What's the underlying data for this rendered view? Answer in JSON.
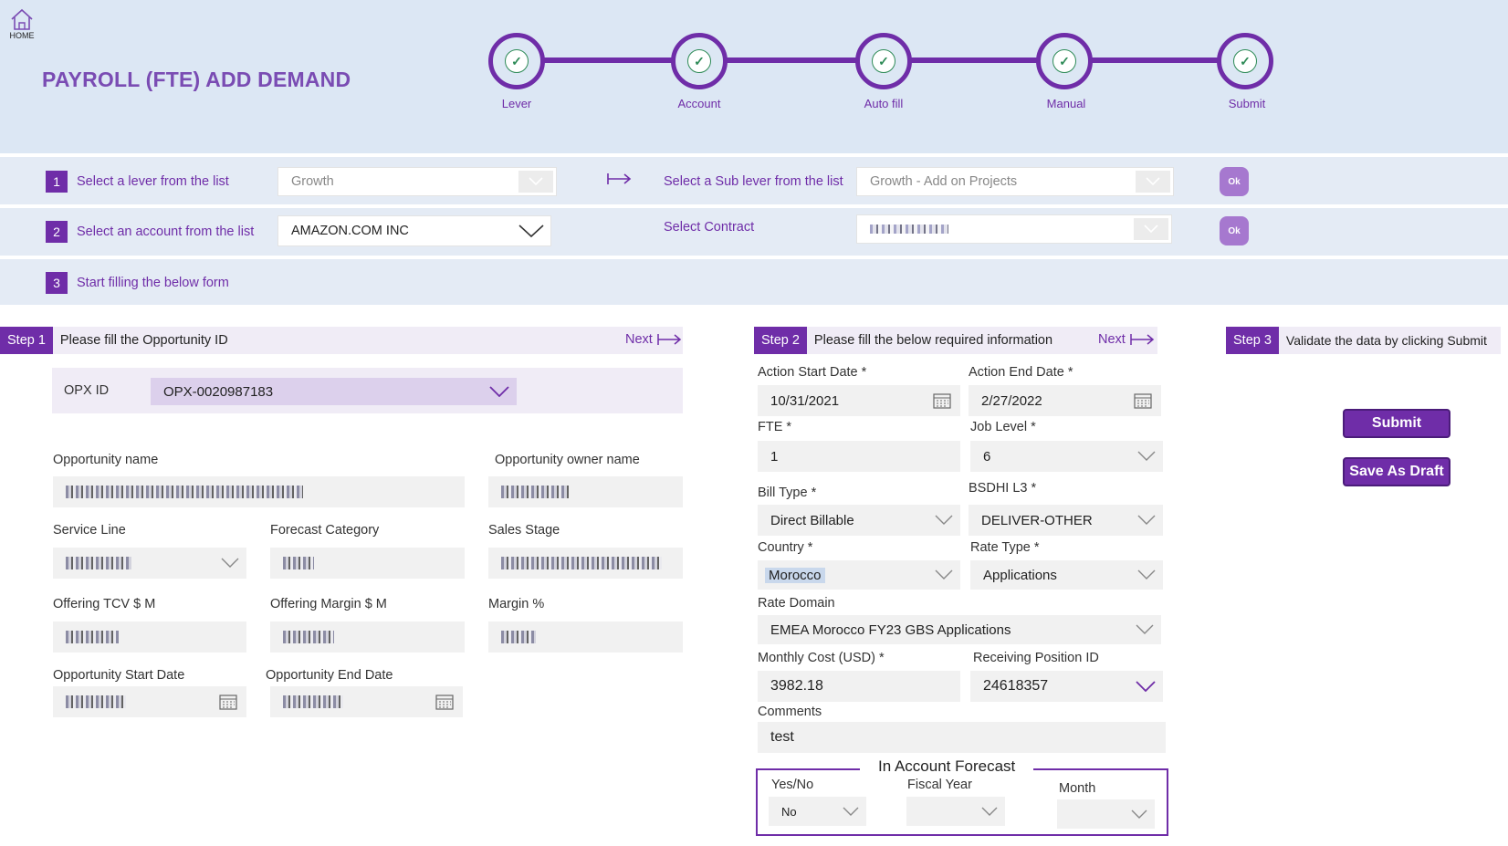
{
  "header": {
    "home_label": "HOME",
    "title": "PAYROLL (FTE) ADD DEMAND",
    "steps": [
      {
        "label": "Lever",
        "done": true
      },
      {
        "label": "Account",
        "done": true
      },
      {
        "label": "Auto fill",
        "done": true
      },
      {
        "label": "Manual",
        "done": true
      },
      {
        "label": "Submit",
        "done": true
      }
    ]
  },
  "selection": {
    "row1": {
      "number": "1",
      "label": "Select a lever from the list",
      "lever_value": "Growth",
      "sub_label": "Select a Sub lever from the list",
      "sub_lever_value": "Growth - Add on Projects",
      "ok": "Ok"
    },
    "row2": {
      "number": "2",
      "label": "Select an account from the list",
      "account_value": "AMAZON.COM INC",
      "contract_label": "Select  Contract",
      "ok": "Ok"
    },
    "row3": {
      "number": "3",
      "label": "Start filling the below form"
    }
  },
  "step1": {
    "tag": "Step 1",
    "title": "Please fill the Opportunity ID",
    "next": "Next",
    "opx_label": "OPX ID",
    "opx_value": "OPX-0020987183",
    "fields": {
      "opportunity_name": "Opportunity name",
      "opportunity_owner": "Opportunity owner name",
      "service_line": "Service Line",
      "forecast_category": "Forecast Category",
      "sales_stage": "Sales Stage",
      "offering_tcv": "Offering TCV $ M",
      "offering_margin": "Offering Margin $ M",
      "margin_pct": "Margin %",
      "opp_start": "Opportunity Start Date",
      "opp_end": "Opportunity End Date"
    }
  },
  "step2": {
    "tag": "Step 2",
    "title": "Please fill the below required information",
    "next": "Next",
    "action_start_label": "Action Start Date *",
    "action_start_value": "10/31/2021",
    "action_end_label": "Action End Date *",
    "action_end_value": "2/27/2022",
    "fte_label": "FTE *",
    "fte_value": "1",
    "job_level_label": "Job Level *",
    "job_level_value": "6",
    "bill_type_label": "Bill Type *",
    "bill_type_value": "Direct Billable",
    "bsdhi_label": "BSDHI L3 *",
    "bsdhi_value": "DELIVER-OTHER",
    "country_label": "Country *",
    "country_value": "Morocco",
    "rate_type_label": "Rate Type *",
    "rate_type_value": "Applications",
    "rate_domain_label": "Rate Domain",
    "rate_domain_value": "EMEA Morocco FY23 GBS Applications",
    "monthly_cost_label": "Monthly Cost (USD) *",
    "monthly_cost_value": "3982.18",
    "receiving_pos_label": "Receiving Position ID",
    "receiving_pos_value": "24618357",
    "comments_label": "Comments",
    "comments_value": "test",
    "forecast": {
      "title": "In Account Forecast",
      "yesno_label": "Yes/No",
      "yesno_value": "No",
      "fiscal_year_label": "Fiscal Year",
      "month_label": "Month"
    }
  },
  "step3": {
    "tag": "Step 3",
    "title": "Validate the data by clicking Submit",
    "submit": "Submit",
    "save_draft": "Save As Draft"
  },
  "colors": {
    "brand": "#6f2da8",
    "header_bg": "#dce7f4",
    "check": "#2e8b57"
  }
}
